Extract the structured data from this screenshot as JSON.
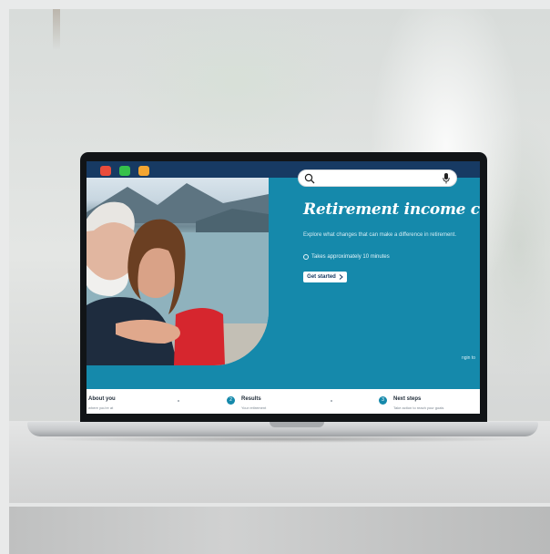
{
  "window": {
    "controls": [
      "close",
      "minimize",
      "maximize"
    ],
    "colors": {
      "close": "#ea4c3b",
      "minimize": "#35c14b",
      "maximize": "#f3a531",
      "titlebar": "#173a63"
    }
  },
  "search": {
    "value": "",
    "placeholder": "",
    "icons": [
      "search-icon",
      "microphone-icon"
    ]
  },
  "hero": {
    "title": "Retirement income calculat",
    "description": "Explore what changes that can make a difference in retirement.",
    "time_note": "Takes approximately 10 minutes",
    "cta_label": "Get started",
    "cta_icon": "chevron-right-icon",
    "side_tab": "ngin to",
    "accent_color": "#1589ab"
  },
  "steps": [
    {
      "title": "About you",
      "subtitle": "where you're at"
    },
    {
      "number": "2",
      "title": "Results",
      "subtitle": "Your retirement"
    },
    {
      "number": "3",
      "title": "Next steps",
      "subtitle": "Take action to reach your goals"
    }
  ]
}
